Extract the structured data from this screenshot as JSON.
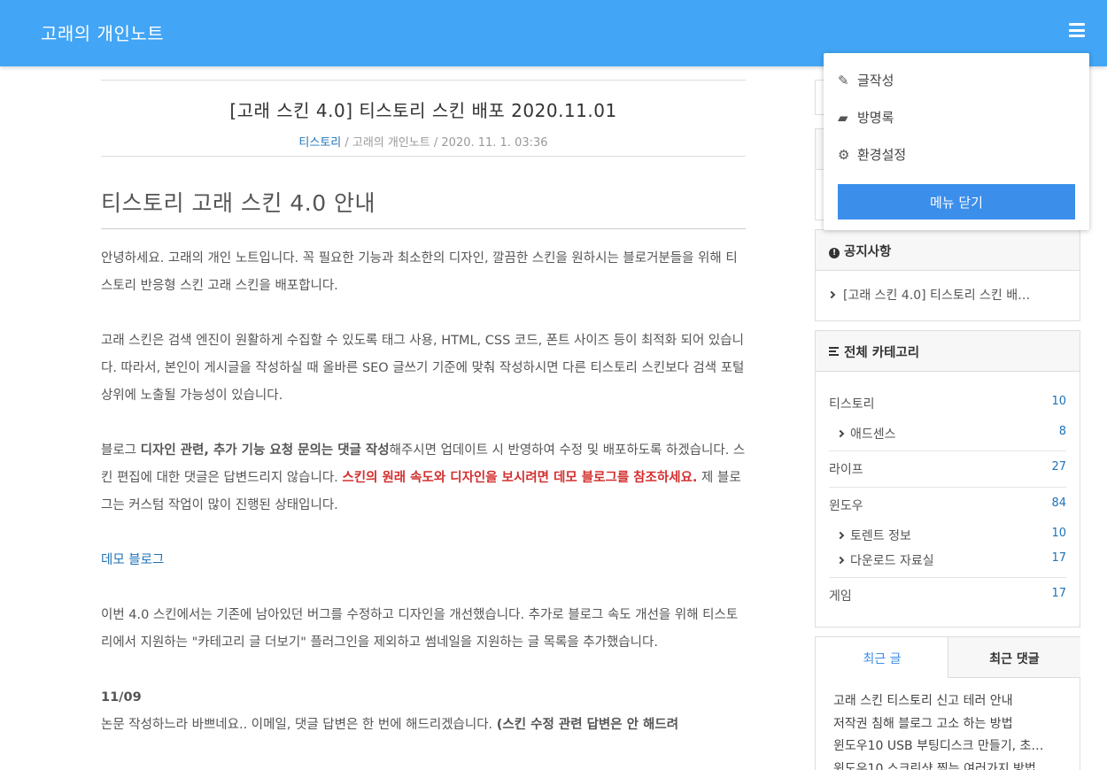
{
  "header": {
    "site_title": "고래의 개인노트",
    "menu_icon": "hamburger-menu-icon"
  },
  "post": {
    "title": "[고래 스킨 4.0] 티스토리 스킨 배포 2020.11.01",
    "category": "티스토리",
    "meta_rest": " / 고래의 개인노트 / 2020. 11. 1. 03:36"
  },
  "content": {
    "heading": "티스토리 고래 스킨 4.0 안내",
    "p1": "안녕하세요. 고래의 개인 노트입니다. 꼭 필요한 기능과 최소한의 디자인, 깔끔한 스킨을 원하시는 블로거분들을 위해 티스토리 반응형 스킨 고래 스킨을 배포합니다.",
    "p2": "고래 스킨은 검색 엔진이 원활하게 수집할 수 있도록 태그 사용, HTML, CSS 코드, 폰트 사이즈 등이 최적화 되어 있습니다. 따라서, 본인이 게시글을 작성하실 때 올바른 SEO 글쓰기 기준에 맞춰 작성하시면 다른 티스토리 스킨보다 검색 포털 상위에 노출될 가능성이 있습니다.",
    "p3_pre": "블로그 ",
    "p3_bold": "디자인 관련, 추가 기능 요청 문의는 댓글 작성",
    "p3_mid": "해주시면 업데이트 시 반영하여 수정 및 배포하도록 하겠습니다. 스킨 편집에 대한 댓글은 답변드리지 않습니다. ",
    "p3_red": "스킨의 원래 속도와 디자인을 보시려면 데모 블로그를 참조하세요.",
    "p3_post": " 제 블로그는 커스텀 작업이 많이 진행된 상태입니다.",
    "demo_link": "데모 블로그",
    "p4": "이번 4.0 스킨에서는 기존에 남아있던 버그를 수정하고 디자인을 개선했습니다. 추가로 블로그 속도 개선을 위해 티스토리에서 지원하는 \"카테고리 글 더보기\" 플러그인을 제외하고 썸네일을 지원하는 글 목록을 추가했습니다.",
    "date": "11/09",
    "p5_pre": "논문 작성하느라 바쁘네요.. 이메일, 댓글 답변은 한 번에 해드리겠습니다. ",
    "p5_bold": "(스킨 수정 관련 답변은 안 해드려"
  },
  "notice": {
    "title": "공지사항",
    "item": "[고래 스킨 4.0] 티스토리 스킨 배…"
  },
  "categories": {
    "title": "전체 카테고리",
    "items": [
      {
        "label": "티스토리",
        "count": "10"
      },
      {
        "label": "애드센스",
        "count": "8"
      },
      {
        "label": "라이프",
        "count": "27"
      },
      {
        "label": "윈도우",
        "count": "84"
      },
      {
        "label": "토렌트 정보",
        "count": "10"
      },
      {
        "label": "다운로드 자료실",
        "count": "17"
      },
      {
        "label": "게임",
        "count": "17"
      }
    ]
  },
  "recent": {
    "tab_posts": "최근 글",
    "tab_comments": "최근 댓글",
    "items": [
      "고래 스킨 티스토리 신고 테러 안내",
      "저작권 침해 블로그 고소 하는 방법",
      "윈도우10 USB 부팅디스크 만들기, 초…",
      "윈도우10 스크린샷 찍는 여러가지 방법"
    ]
  },
  "dropdown": {
    "write": "글작성",
    "guestbook": "방명록",
    "settings": "환경설정",
    "close": "메뉴 닫기"
  },
  "colors": {
    "header": "#42a5f5",
    "link": "#1f73b7",
    "accent_red": "#d32f2f",
    "button": "#3b8eea"
  }
}
